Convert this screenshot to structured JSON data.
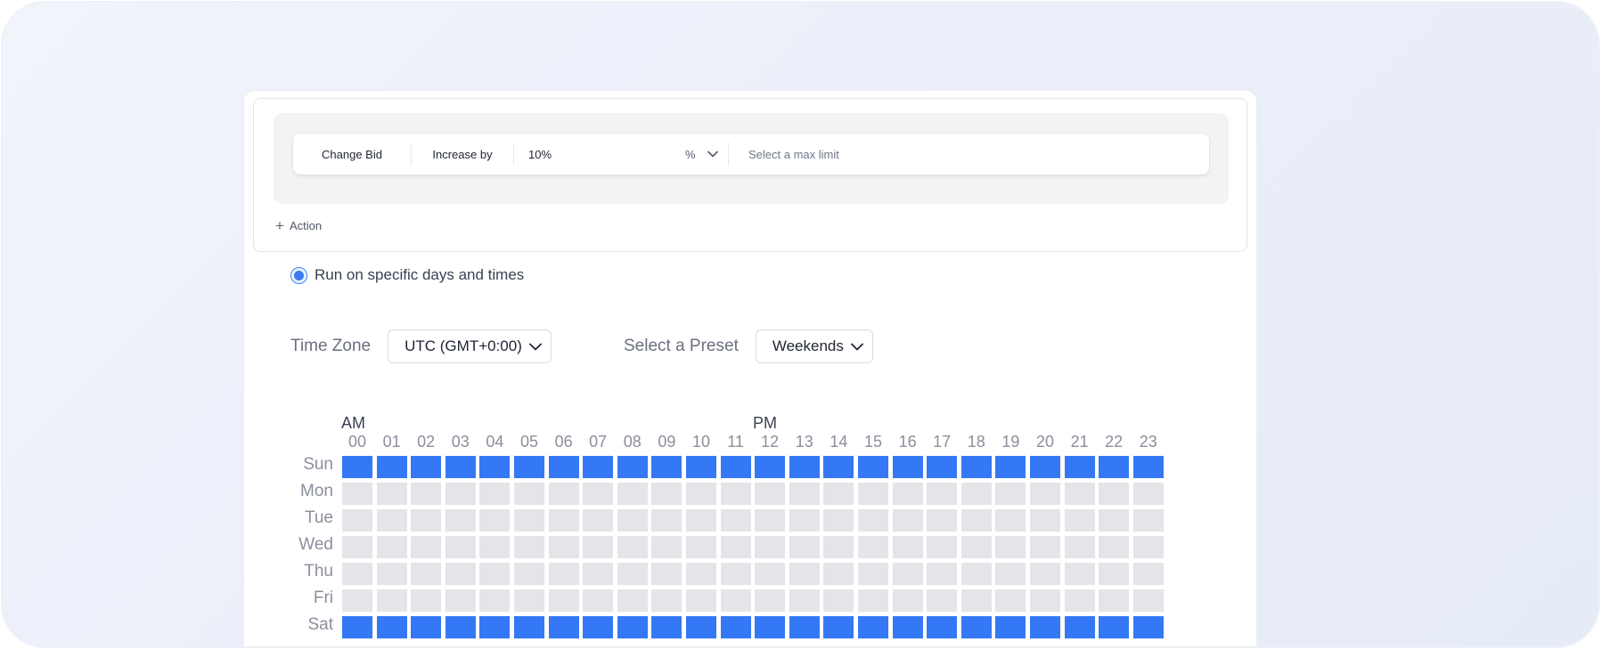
{
  "action": {
    "type_label": "Change Bid",
    "direction_label": "Increase by",
    "amount_value": "10%",
    "unit_label": "%",
    "max_limit_placeholder": "Select a max limit",
    "add_action_label": "Action"
  },
  "schedule": {
    "radio_label": "Run on specific days and times",
    "timezone_label": "Time Zone",
    "timezone_value": "UTC (GMT+0:00)",
    "preset_label": "Select a Preset",
    "preset_value": "Weekends"
  },
  "grid": {
    "am_label": "AM",
    "pm_label": "PM",
    "hours": [
      "00",
      "01",
      "02",
      "03",
      "04",
      "05",
      "06",
      "07",
      "08",
      "09",
      "10",
      "11",
      "12",
      "13",
      "14",
      "15",
      "16",
      "17",
      "18",
      "19",
      "20",
      "21",
      "22",
      "23"
    ],
    "days": [
      "Sun",
      "Mon",
      "Tue",
      "Wed",
      "Thu",
      "Fri",
      "Sat"
    ],
    "selected_days": [
      "Sun",
      "Sat"
    ],
    "on_color": "#3478f6",
    "off_color": "#e4e5e8"
  }
}
